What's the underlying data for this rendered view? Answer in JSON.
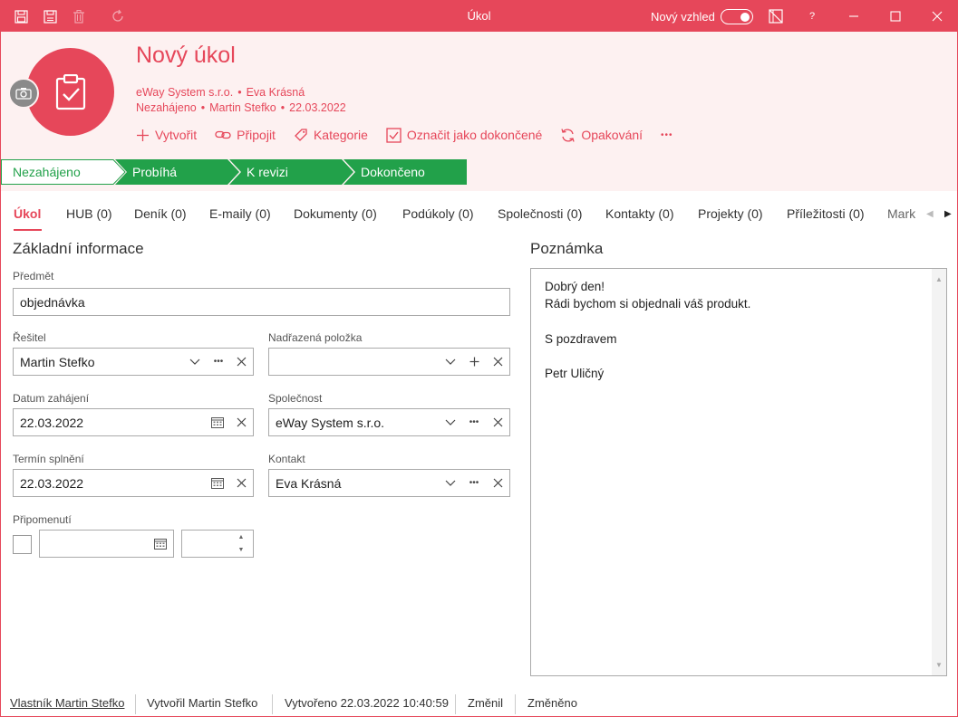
{
  "titlebar": {
    "title": "Úkol",
    "new_look_label": "Nový vzhled",
    "help_label": "?",
    "accent_color": "#e6475a"
  },
  "header": {
    "title": "Nový úkol",
    "company": "eWay System s.r.o.",
    "contact": "Eva Krásná",
    "state": "Nezahájeno",
    "solver": "Martin Stefko",
    "date": "22.03.2022",
    "dot": "•"
  },
  "actions": {
    "create": "Vytvořit",
    "attach": "Připojit",
    "category": "Kategorie",
    "mark_done": "Označit jako dokončené",
    "repeat": "Opakování",
    "more": "•••"
  },
  "stages": [
    "Nezahájeno",
    "Probíhá",
    "K revizi",
    "Dokončeno"
  ],
  "stage_colors": {
    "active_fill": "#ffffff",
    "done_fill": "#22a14a"
  },
  "tabs": [
    "Úkol",
    "HUB (0)",
    "Deník (0)",
    "E-maily (0)",
    "Dokumenty (0)",
    "Podúkoly (0)",
    "Společnosti (0)",
    "Kontakty (0)",
    "Projekty (0)",
    "Příležitosti (0)",
    "Mark"
  ],
  "form": {
    "section_title": "Základní informace",
    "subject_label": "Předmět",
    "subject_value": "objednávka",
    "solver_label": "Řešitel",
    "solver_value": "Martin Stefko",
    "parent_label": "Nadřazená položka",
    "parent_value": "",
    "start_label": "Datum zahájení",
    "start_value": "22.03.2022",
    "company_label": "Společnost",
    "company_value": "eWay System s.r.o.",
    "due_label": "Termín splnění",
    "due_value": "22.03.2022",
    "contact_label": "Kontakt",
    "contact_value": "Eva Krásná",
    "reminder_label": "Připomenutí",
    "reminder_date": "",
    "reminder_time": ""
  },
  "note": {
    "title": "Poznámka",
    "lines": [
      "Dobrý den!",
      "Rádi bychom si objednali váš produkt.",
      "",
      "S pozdravem",
      "",
      "Petr Uličný"
    ]
  },
  "footer": {
    "owner": "Vlastník Martin Stefko",
    "created_by": "Vytvořil Martin Stefko",
    "created_at": "Vytvořeno 22.03.2022 10:40:59",
    "changed_by": "Změnil",
    "changed_at": "Změněno"
  }
}
